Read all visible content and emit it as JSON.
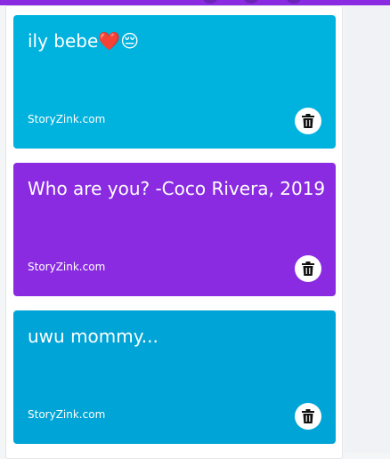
{
  "cards": [
    {
      "title": "ily bebe❤️😔",
      "source": "StoryZink.com",
      "color": "#00b2de"
    },
    {
      "title": "Who are you? -Coco Rivera, 2019",
      "source": "StoryZink.com",
      "color": "#8a2be2"
    },
    {
      "title": "uwu mommy...",
      "source": "StoryZink.com",
      "color": "#00a4d6"
    }
  ],
  "icons": {
    "delete": "trash-icon"
  },
  "colors": {
    "accent": "#8a2be2",
    "panel": "#ffffff",
    "background": "#f4f5f7"
  }
}
